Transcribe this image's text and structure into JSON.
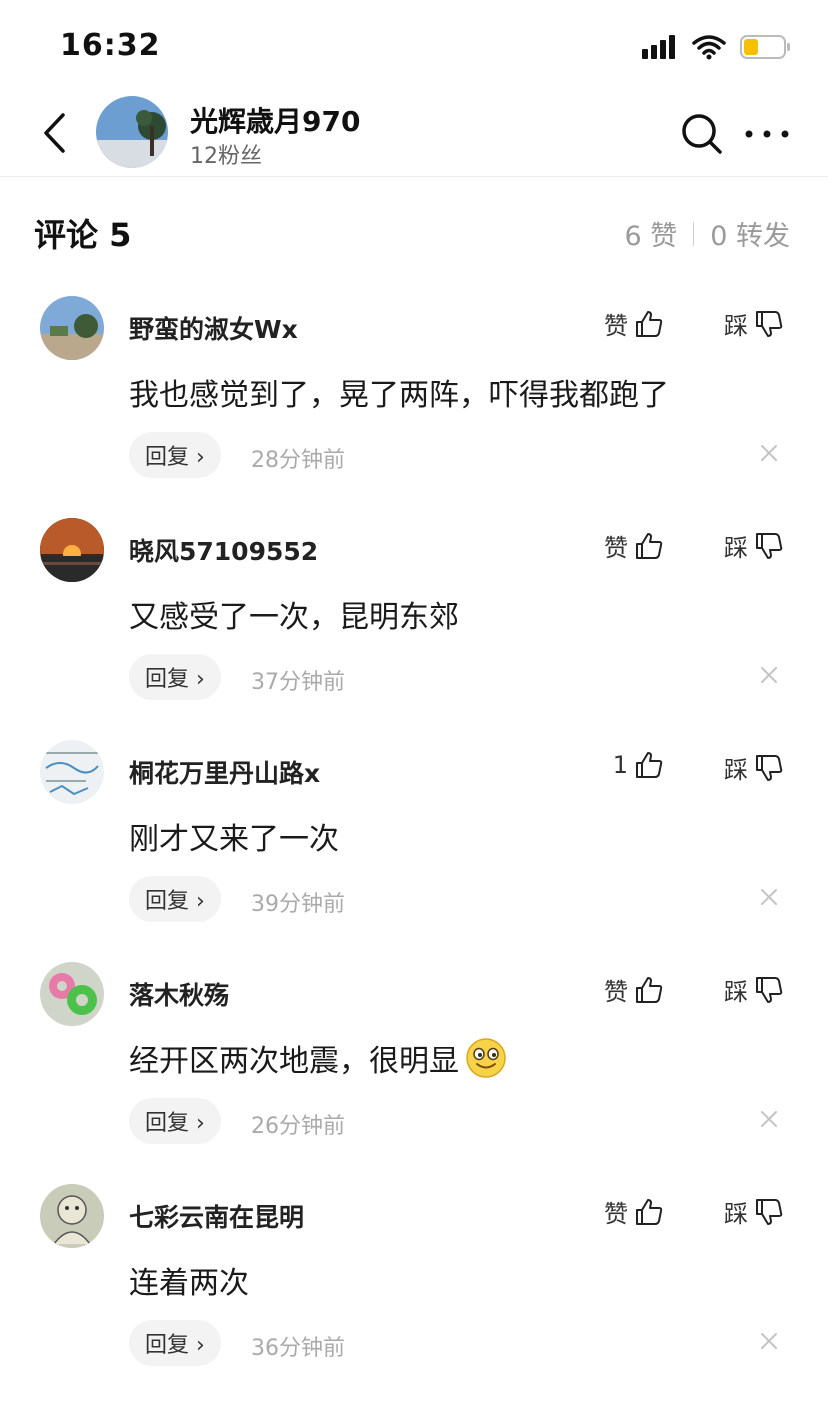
{
  "status_bar": {
    "time": "16:32"
  },
  "header": {
    "username": "光辉歳月970",
    "fans": "12粉丝"
  },
  "comments_section": {
    "title": "评论 5",
    "likes": "6 赞",
    "reposts": "0 转发"
  },
  "comments": [
    {
      "name": "野蛮的淑女Wx",
      "text": "我也感觉到了，晃了两阵，吓得我都跑了",
      "like_label": "赞",
      "dislike_label": "踩",
      "reply_label": "回复 ›",
      "time": "28分钟前"
    },
    {
      "name": "晓风57109552",
      "text": "又感受了一次，昆明东郊",
      "like_label": "赞",
      "dislike_label": "踩",
      "reply_label": "回复 ›",
      "time": "37分钟前"
    },
    {
      "name": "桐花万里丹山路x",
      "text": "刚才又来了一次",
      "like_label": "1",
      "dislike_label": "踩",
      "reply_label": "回复 ›",
      "time": "39分钟前"
    },
    {
      "name": "落木秋殇",
      "text": "经开区两次地震，很明显",
      "like_label": "赞",
      "dislike_label": "踩",
      "reply_label": "回复 ›",
      "time": "26分钟前"
    },
    {
      "name": "七彩云南在昆明",
      "text": "连着两次",
      "like_label": "赞",
      "dislike_label": "踩",
      "reply_label": "回复 ›",
      "time": "36分钟前"
    }
  ]
}
